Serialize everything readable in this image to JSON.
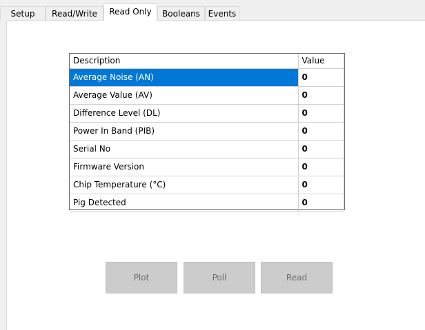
{
  "tabs": [
    {
      "label": "Setup"
    },
    {
      "label": "Read/Write"
    },
    {
      "label": "Read Only"
    },
    {
      "label": "Booleans"
    },
    {
      "label": "Events"
    }
  ],
  "active_tab": "Read Only",
  "table": {
    "headers": {
      "description": "Description",
      "value": "Value"
    },
    "rows": [
      {
        "description": "Average Noise (AN)",
        "value": "0"
      },
      {
        "description": "Average Value (AV)",
        "value": "0"
      },
      {
        "description": "Difference Level (DL)",
        "value": "0"
      },
      {
        "description": "Power In Band (PIB)",
        "value": "0"
      },
      {
        "description": "Serial No",
        "value": "0"
      },
      {
        "description": "Firmware Version",
        "value": "0"
      },
      {
        "description": "Chip Temperature (°C)",
        "value": "0"
      },
      {
        "description": "Pig Detected",
        "value": "0"
      }
    ],
    "selected_row": "Average Noise (AN)"
  },
  "buttons": {
    "plot": "Plot",
    "poll": "Poll",
    "read": "Read"
  },
  "colors": {
    "selection": "#0078d7",
    "button_disabled": "#cccccc"
  }
}
